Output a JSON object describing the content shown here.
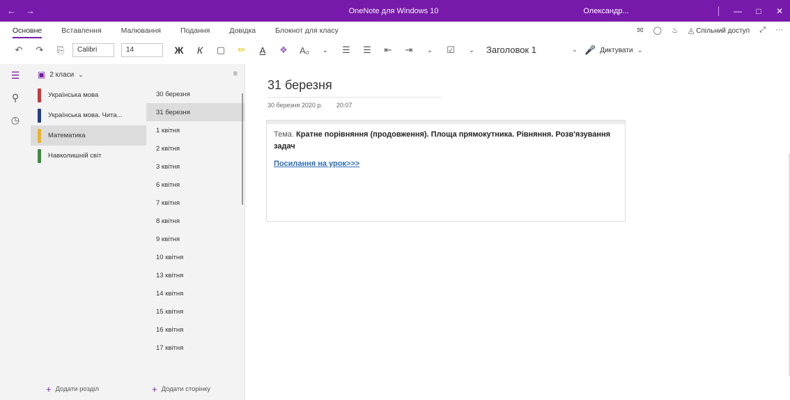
{
  "titlebar": {
    "title": "OneNote для Windows 10",
    "user": "Олександр..."
  },
  "ribbon": {
    "tabs": [
      "Основне",
      "Вставлення",
      "Малювання",
      "Подання",
      "Довідка",
      "Блокнот для класу"
    ],
    "share_label": "Спільний доступ"
  },
  "toolbar": {
    "font_name": "Calibri",
    "font_size": "14",
    "bold_label": "Ж",
    "italic_label": "К",
    "style_label": "Заголовок 1",
    "dictate_label": "Диктувати"
  },
  "notebook": {
    "name": "2 класи"
  },
  "sections": [
    {
      "label": "Українська мова",
      "color": "#d13438"
    },
    {
      "label": "Українська мова. Чита...",
      "color": "#1e3f8c"
    },
    {
      "label": "Математика",
      "color": "#f2b21a"
    },
    {
      "label": "Навколишній світ",
      "color": "#3a8f3a"
    }
  ],
  "sections_add_label": "Додати розділ",
  "pages": [
    "30 березня",
    "31 березня",
    "1 квітня",
    "2 квітня",
    "3 квітня",
    "6 квітня",
    "7 квітня",
    "8 квітня",
    "9 квітня",
    "10 квітня",
    "13 квітня",
    "14 квітня",
    "15 квітня",
    "16 квітня",
    "17 квітня"
  ],
  "pages_add_label": "Додати сторінку",
  "page": {
    "title": "31 березня",
    "date": "30 березня 2020 р.",
    "time": "20:07",
    "note_label": "Тема.",
    "note_topic": "Кратне порівняння (продовження). Площа прямокутника. Рівняння. Розв'язування задач",
    "note_link": "Посилання на урок>>>"
  },
  "colors": {
    "accent": "#7719aa"
  }
}
